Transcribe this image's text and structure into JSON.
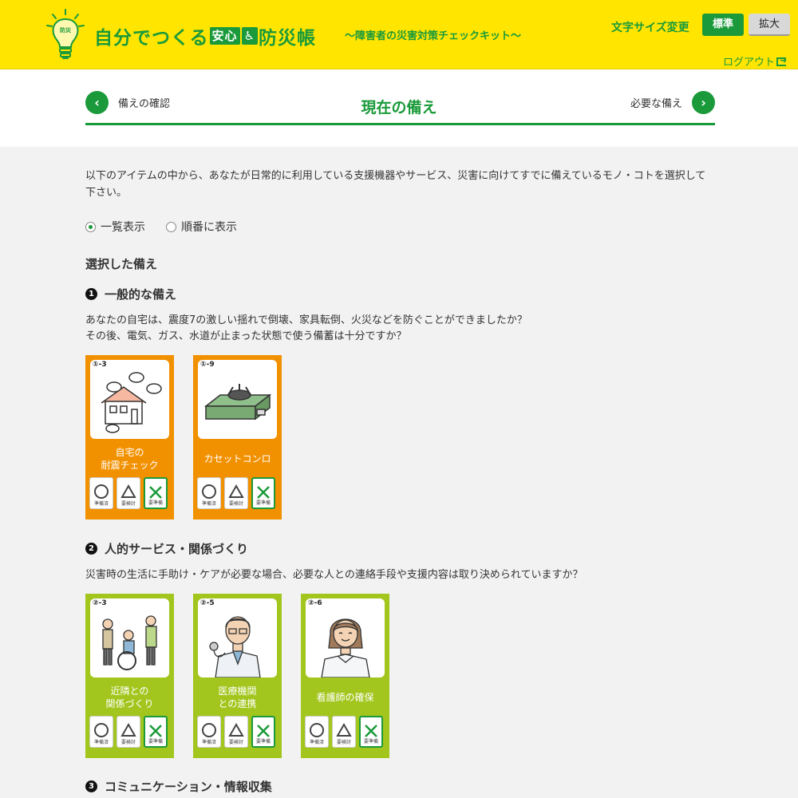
{
  "header": {
    "logo_part1": "自分でつくる",
    "logo_box1": "安心",
    "logo_box2": "♿",
    "logo_part2": "防災帳",
    "subtitle": "〜障害者の災害対策チェックキット〜",
    "bulb_text": "防災",
    "font_size_label": "文字サイズ変更",
    "standard_label": "標準",
    "large_label": "拡大",
    "logout_label": "ログアウト"
  },
  "nav": {
    "prev_label": "備えの確認",
    "title": "現在の備え",
    "next_label": "必要な備え"
  },
  "intro": "以下のアイテムの中から、あなたが日常的に利用している支援機器やサービス、災害に向けてすでに備えているモノ・コトを選択して下さい。",
  "view_options": {
    "list_label": "一覧表示",
    "sequential_label": "順番に表示",
    "selected": "list"
  },
  "selected_title": "選択した備え",
  "sections": [
    {
      "number": "1",
      "title": "一般的な備え",
      "desc_line1": "あなたの自宅は、震度7の激しい揺れで倒壊、家具転倒、火災などを防ぐことができましたか？",
      "desc_line2": "その後、電気、ガス、水道が止まった状態で使う備蓄は十分ですか？",
      "color": "#f29100",
      "cards": [
        {
          "code": "①-3",
          "name": "自宅の\n耐震チェック",
          "icon": "house-icon"
        },
        {
          "code": "①-9",
          "name": "カセットコンロ",
          "icon": "gas-stove-icon"
        }
      ]
    },
    {
      "number": "2",
      "title": "人的サービス・関係づくり",
      "desc_line1": "災害時の生活に手助け・ケアが必要な場合、必要な人との連絡手段や支援内容は取り決められていますか？",
      "color": "#a2c61d",
      "cards": [
        {
          "code": "②-3",
          "name": "近隣との\n関係づくり",
          "icon": "neighbors-icon"
        },
        {
          "code": "②-5",
          "name": "医療機関\nとの連携",
          "icon": "doctor-icon"
        },
        {
          "code": "②-6",
          "name": "看護師の確保",
          "icon": "nurse-icon"
        }
      ]
    },
    {
      "number": "3",
      "title": "コミュニケーション・情報収集"
    }
  ],
  "marks": {
    "done_label": "準備済",
    "review_label": "要検討",
    "needed_label": "要準備"
  }
}
